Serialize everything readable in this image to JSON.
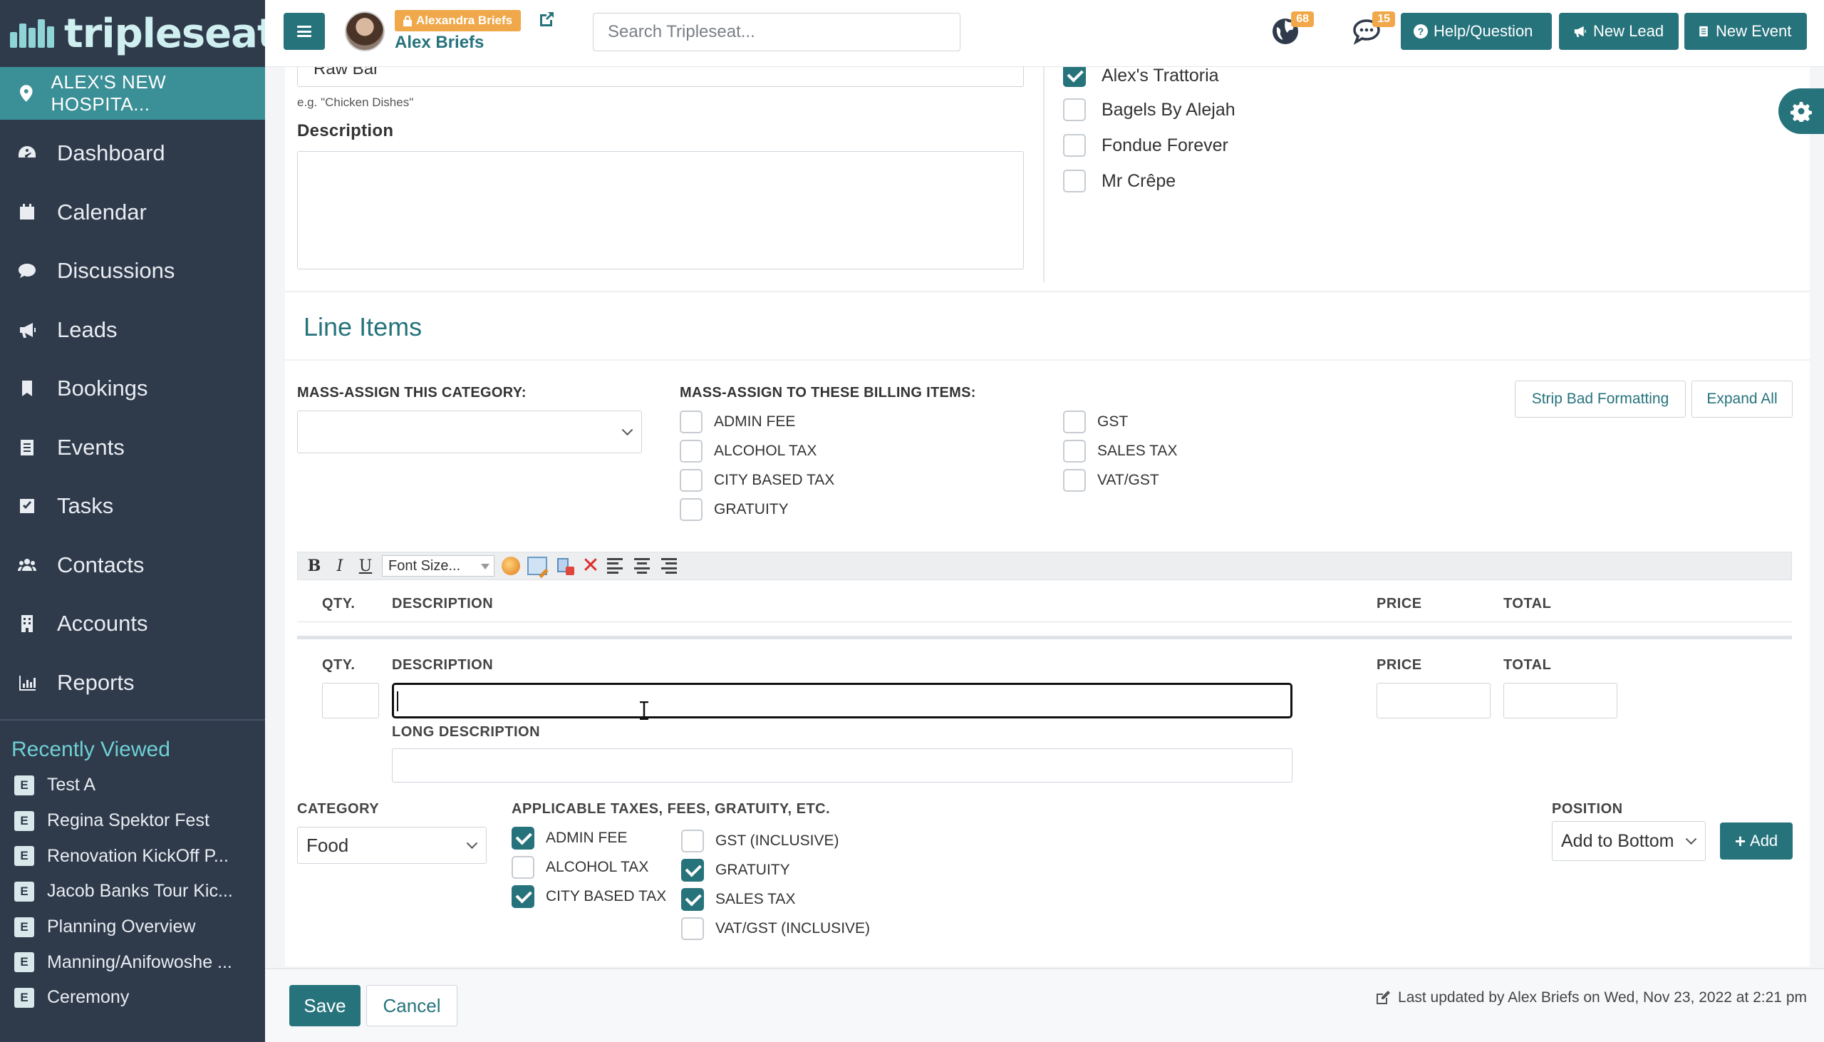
{
  "app": {
    "logo_text": "tripleseat",
    "venue": "ALEX'S NEW HOSPITA...",
    "colors": {
      "sidebar": "#2f3a4b",
      "accent": "#26737c",
      "venue_bar": "#3b8f96",
      "badge": "#f0a84a",
      "recent_title": "#6fd0d4"
    }
  },
  "nav": [
    {
      "label": "Dashboard",
      "icon": "dashboard-icon"
    },
    {
      "label": "Calendar",
      "icon": "calendar-icon"
    },
    {
      "label": "Discussions",
      "icon": "chat-bubble-icon"
    },
    {
      "label": "Leads",
      "icon": "bullhorn-icon"
    },
    {
      "label": "Bookings",
      "icon": "bookmark-icon"
    },
    {
      "label": "Events",
      "icon": "document-icon"
    },
    {
      "label": "Tasks",
      "icon": "checkbox-icon"
    },
    {
      "label": "Contacts",
      "icon": "users-icon"
    },
    {
      "label": "Accounts",
      "icon": "building-icon"
    },
    {
      "label": "Reports",
      "icon": "bar-chart-icon"
    }
  ],
  "recent": {
    "title": "Recently Viewed",
    "badge": "E",
    "items": [
      "Test A",
      "Regina Spektor Fest",
      "Renovation KickOff P...",
      "Jacob Banks Tour Kic...",
      "Planning Overview",
      "Manning/Anifowoshe ...",
      "Ceremony"
    ]
  },
  "topbar": {
    "user_tag": "Alexandra Briefs",
    "user_name": "Alex Briefs",
    "search_placeholder": "Search Tripleseat...",
    "notifications": "68",
    "messages": "15",
    "help_label": "Help/Question",
    "new_lead_label": "New Lead",
    "new_event_label": "New Event"
  },
  "form": {
    "name_value": "Raw Bar",
    "name_hint": "e.g. \"Chicken Dishes\"",
    "description_label": "Description",
    "venues": [
      {
        "label": "Alex's Trattoria",
        "checked": true
      },
      {
        "label": "Bagels By Alejah",
        "checked": false
      },
      {
        "label": "Fondue Forever",
        "checked": false
      },
      {
        "label": "Mr Crêpe",
        "checked": false
      }
    ]
  },
  "line_items": {
    "title": "Line Items",
    "mass_category_label": "MASS-ASSIGN THIS CATEGORY:",
    "mass_billing_label": "MASS-ASSIGN TO THESE BILLING ITEMS:",
    "billing_col1": [
      {
        "label": "ADMIN FEE",
        "checked": false
      },
      {
        "label": "ALCOHOL TAX",
        "checked": false
      },
      {
        "label": "CITY BASED TAX",
        "checked": false
      },
      {
        "label": "GRATUITY",
        "checked": false
      }
    ],
    "billing_col2": [
      {
        "label": "GST",
        "checked": false
      },
      {
        "label": "SALES TAX",
        "checked": false
      },
      {
        "label": "VAT/GST",
        "checked": false
      }
    ],
    "strip_label": "Strip Bad Formatting",
    "expand_label": "Expand All",
    "toolbar": {
      "bold": "B",
      "italic": "I",
      "underline": "U",
      "font_size": "Font Size..."
    },
    "headers": {
      "qty": "QTY.",
      "description": "DESCRIPTION",
      "price": "PRICE",
      "total": "TOTAL"
    },
    "long_description_label": "LONG DESCRIPTION",
    "category_label": "CATEGORY",
    "category_value": "Food",
    "taxes_label": "APPLICABLE TAXES, FEES, GRATUITY, ETC.",
    "taxes_col1": [
      {
        "label": "ADMIN FEE",
        "checked": true
      },
      {
        "label": "ALCOHOL TAX",
        "checked": false
      },
      {
        "label": "CITY BASED TAX",
        "checked": true
      }
    ],
    "taxes_col2": [
      {
        "label": "GST (INCLUSIVE)",
        "checked": false
      },
      {
        "label": "GRATUITY",
        "checked": true
      },
      {
        "label": "SALES TAX",
        "checked": true
      },
      {
        "label": "VAT/GST (INCLUSIVE)",
        "checked": false
      }
    ],
    "position_label": "POSITION",
    "position_value": "Add to Bottom",
    "add_label": "Add"
  },
  "footer": {
    "save_label": "Save",
    "cancel_label": "Cancel",
    "last_updated": "Last updated by Alex Briefs on Wed, Nov 23, 2022 at 2:21 pm"
  }
}
